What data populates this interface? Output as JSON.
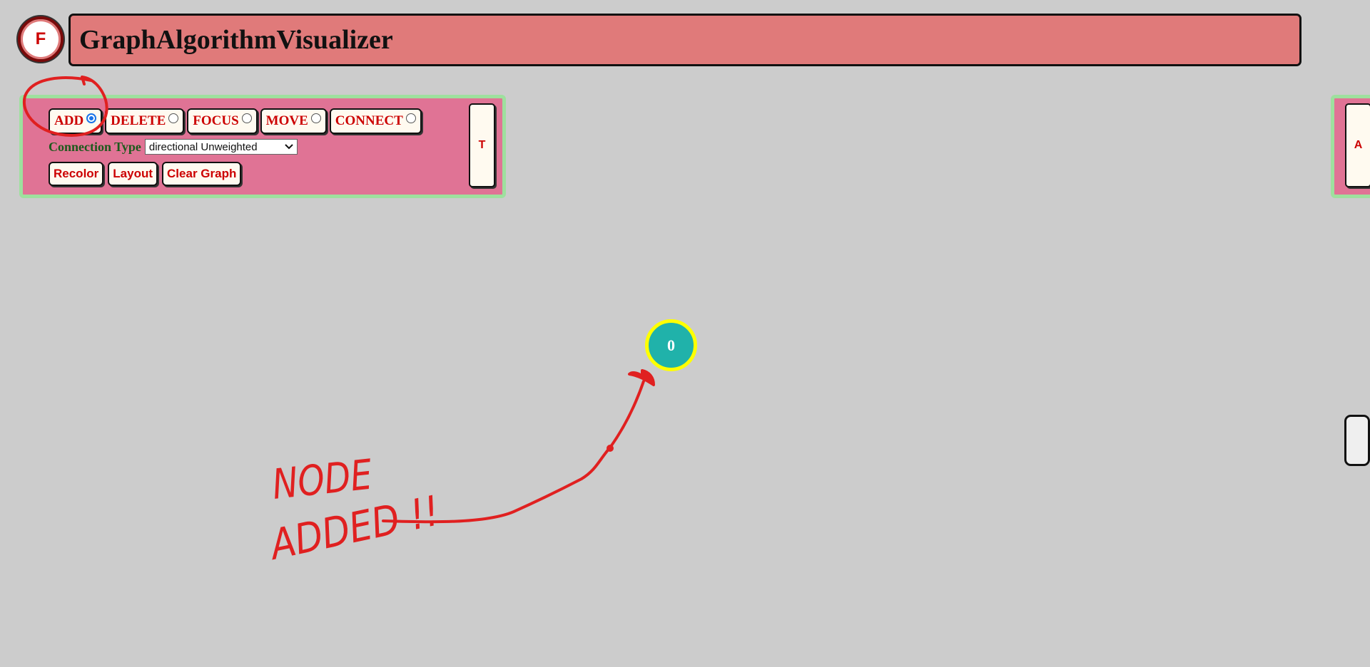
{
  "header": {
    "logo_letter": "F",
    "title": "GraphAlgorithmVisualizer"
  },
  "toolbar": {
    "modes": [
      {
        "label": "ADD",
        "checked": true
      },
      {
        "label": "DELETE",
        "checked": false
      },
      {
        "label": "FOCUS",
        "checked": false
      },
      {
        "label": "MOVE",
        "checked": false
      },
      {
        "label": "CONNECT",
        "checked": false
      }
    ],
    "connection_type_label": "Connection Type",
    "connection_type_value": "directional Unweighted",
    "actions": {
      "recolor": "Recolor",
      "layout": "Layout",
      "clear": "Clear Graph"
    },
    "side_tab_label": "T"
  },
  "right_panel": {
    "tab_label": "A"
  },
  "graph": {
    "nodes": [
      {
        "label": "0"
      }
    ]
  },
  "annotation": {
    "line1": "NODE",
    "line2": "ADDED !!"
  },
  "colors": {
    "background": "#cccccc",
    "title_bar": "#e07a7a",
    "panel": "#e07395",
    "panel_border": "#9ee09e",
    "button_text": "#cc0000",
    "node_fill": "#20b2aa",
    "node_ring": "#ffff00",
    "annotation": "#e02020"
  }
}
